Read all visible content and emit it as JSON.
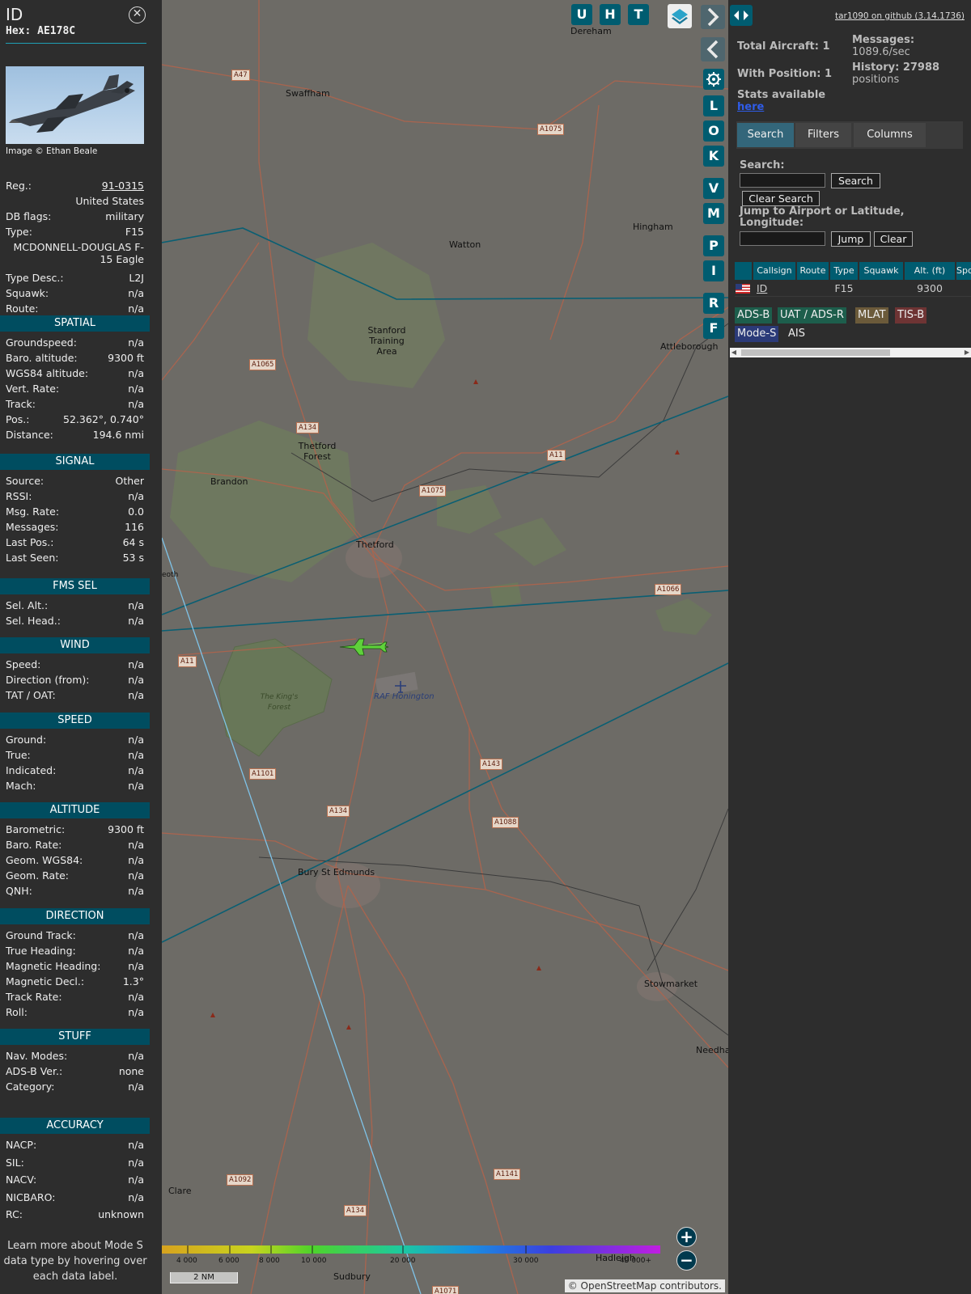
{
  "info": {
    "title": "ID",
    "hex": "Hex: AE178C",
    "photo_credit": "Image © Ethan Beale",
    "identity": [
      {
        "label": "Reg.:",
        "value": "91-0315"
      },
      {
        "label": "",
        "value": "United States"
      },
      {
        "label": "DB flags:",
        "value": "military"
      },
      {
        "label": "Type:",
        "value": "F15"
      },
      {
        "label": "",
        "value": "MCDONNELL-DOUGLAS F-15 Eagle"
      },
      {
        "label": "Type Desc.:",
        "value": "L2J"
      },
      {
        "label": "Squawk:",
        "value": "n/a"
      },
      {
        "label": "Route:",
        "value": "n/a"
      }
    ],
    "sections": [
      {
        "title": "SPATIAL",
        "rows": [
          {
            "label": "Groundspeed:",
            "value": "n/a"
          },
          {
            "label": "Baro. altitude:",
            "value": "9300 ft"
          },
          {
            "label": "WGS84 altitude:",
            "value": "n/a"
          },
          {
            "label": "Vert. Rate:",
            "value": "n/a"
          },
          {
            "label": "Track:",
            "value": "n/a"
          },
          {
            "label": "Pos.:",
            "value": "52.362°, 0.740°"
          },
          {
            "label": "Distance:",
            "value": "194.6 nmi"
          }
        ]
      },
      {
        "title": "SIGNAL",
        "rows": [
          {
            "label": "Source:",
            "value": "Other"
          },
          {
            "label": "RSSI:",
            "value": "n/a"
          },
          {
            "label": "Msg. Rate:",
            "value": "0.0"
          },
          {
            "label": "Messages:",
            "value": "116"
          },
          {
            "label": "Last Pos.:",
            "value": "64 s"
          },
          {
            "label": "Last Seen:",
            "value": "53 s"
          }
        ]
      },
      {
        "title": "FMS SEL",
        "rows": [
          {
            "label": "Sel. Alt.:",
            "value": "n/a"
          },
          {
            "label": "Sel. Head.:",
            "value": "n/a"
          }
        ]
      },
      {
        "title": "WIND",
        "rows": [
          {
            "label": "Speed:",
            "value": "n/a"
          },
          {
            "label": "Direction (from):",
            "value": "n/a"
          },
          {
            "label": "TAT / OAT:",
            "value": "n/a"
          }
        ]
      },
      {
        "title": "SPEED",
        "rows": [
          {
            "label": "Ground:",
            "value": "n/a"
          },
          {
            "label": "True:",
            "value": "n/a"
          },
          {
            "label": "Indicated:",
            "value": "n/a"
          },
          {
            "label": "Mach:",
            "value": "n/a"
          }
        ]
      },
      {
        "title": "ALTITUDE",
        "rows": [
          {
            "label": "Barometric:",
            "value": "9300 ft"
          },
          {
            "label": "Baro. Rate:",
            "value": "n/a"
          },
          {
            "label": "Geom. WGS84:",
            "value": "n/a"
          },
          {
            "label": "Geom. Rate:",
            "value": "n/a"
          },
          {
            "label": "QNH:",
            "value": "n/a"
          }
        ]
      },
      {
        "title": "DIRECTION",
        "rows": [
          {
            "label": "Ground Track:",
            "value": "n/a"
          },
          {
            "label": "True Heading:",
            "value": "n/a"
          },
          {
            "label": "Magnetic Heading:",
            "value": "n/a"
          },
          {
            "label": "Magnetic Decl.:",
            "value": "1.3°"
          },
          {
            "label": "Track Rate:",
            "value": "n/a"
          },
          {
            "label": "Roll:",
            "value": "n/a"
          }
        ]
      },
      {
        "title": "STUFF",
        "rows": [
          {
            "label": "Nav. Modes:",
            "value": "n/a"
          },
          {
            "label": "ADS-B Ver.:",
            "value": "none"
          },
          {
            "label": "Category:",
            "value": "n/a"
          }
        ]
      },
      {
        "title": "ACCURACY",
        "rows": [
          {
            "label": "NACP:",
            "value": "n/a"
          },
          {
            "label": "SIL:",
            "value": "n/a"
          },
          {
            "label": "NACV:",
            "value": "n/a"
          },
          {
            "label": "NICBARO:",
            "value": "n/a"
          },
          {
            "label": "RC:",
            "value": "unknown"
          }
        ]
      }
    ],
    "footer_note": "Learn more about Mode S data type by hovering over each data label."
  },
  "map": {
    "top_buttons": [
      "U",
      "H",
      "T"
    ],
    "side_buttons": [
      "L",
      "O",
      "K",
      "V",
      "M",
      "P",
      "I",
      "R",
      "F"
    ],
    "places": [
      {
        "name": "Dereham"
      },
      {
        "name": "Swaffham"
      },
      {
        "name": "Watton"
      },
      {
        "name": "Hingham"
      },
      {
        "name": "Stanford Training Area"
      },
      {
        "name": "Attleborough"
      },
      {
        "name": "Thetford Forest"
      },
      {
        "name": "Brandon"
      },
      {
        "name": "Thetford"
      },
      {
        "name": "The King's Forest"
      },
      {
        "name": "RAF Honington"
      },
      {
        "name": "Bury St Edmunds"
      },
      {
        "name": "Stowmarket"
      },
      {
        "name": "Needha"
      },
      {
        "name": "Clare"
      },
      {
        "name": "Sudbury"
      },
      {
        "name": "Hadleigh"
      },
      {
        "name": "eoth"
      }
    ],
    "roads": [
      "A47",
      "A1075",
      "A1065",
      "A134",
      "A11",
      "A1075",
      "A1066",
      "A11",
      "A1101",
      "A143",
      "A134",
      "A1088",
      "A1141",
      "A1092",
      "A134",
      "A1071"
    ],
    "altitude_scale": [
      "4 000",
      "6 000",
      "8 000",
      "10 000",
      "20 000",
      "30 000",
      "40 000+"
    ],
    "scale_bar": "2 NM",
    "attribution": "© OpenStreetMap contributors.",
    "zoom_in": "+",
    "zoom_out": "−"
  },
  "side": {
    "github_link": "tar1090 on github (3.14.1736)",
    "total_aircraft": "Total Aircraft: 1",
    "with_position": "With Position: 1",
    "messages_label": "Messages:",
    "messages_value": "1089.6/sec",
    "history_label": "History: 27988",
    "history_value": "positions",
    "stats_text": "Stats available",
    "stats_link": "here",
    "tabs": [
      "Search",
      "Filters",
      "Columns"
    ],
    "search_label": "Search:",
    "search_button": "Search",
    "clear_search_button": "Clear Search",
    "jump_label": "Jump to Airport or Latitude, Longitude:",
    "jump_button": "Jump",
    "clear_button": "Clear",
    "table_headers": [
      "Callsign",
      "Route",
      "Type",
      "Squawk",
      "Alt. (ft)",
      "Spd."
    ],
    "table_rows": [
      {
        "callsign": "ID",
        "route": "",
        "type": "F15",
        "squawk": "",
        "alt": "9300",
        "spd": ""
      }
    ],
    "source_badges": [
      {
        "label": "ADS-B",
        "color": "#1d5e4c"
      },
      {
        "label": "UAT / ADS-R",
        "color": "#1d5e4c"
      },
      {
        "label": "MLAT",
        "color": "#6b5a3a"
      },
      {
        "label": "TIS-B",
        "color": "#6e3434"
      },
      {
        "label": "Mode-S",
        "color": "#2b3a78"
      },
      {
        "label": "AIS",
        "color": "#2d2d2d"
      }
    ]
  }
}
